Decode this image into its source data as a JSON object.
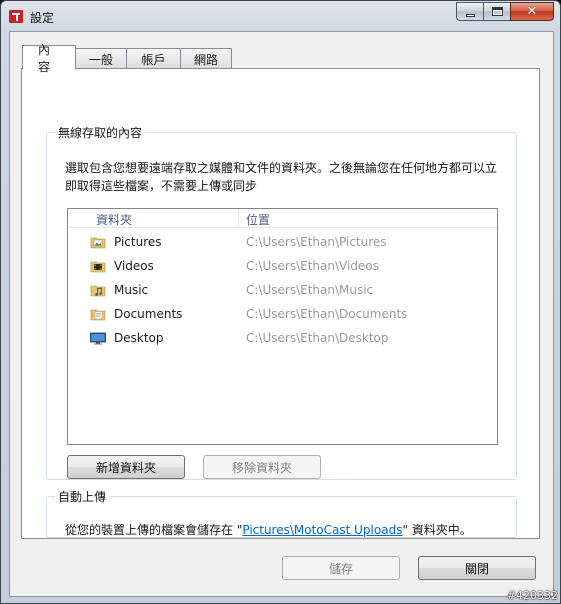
{
  "window": {
    "title": "設定"
  },
  "tabs": [
    {
      "label": "內容",
      "active": true
    },
    {
      "label": "一般",
      "active": false
    },
    {
      "label": "帳戶",
      "active": false
    },
    {
      "label": "網路",
      "active": false
    }
  ],
  "wireless": {
    "legend": "無線存取的內容",
    "description": "選取包含您想要遠端存取之媒體和文件的資料夾。之後無論您在任何地方都可以立即取得這些檔案，不需要上傳或同步",
    "columns": {
      "folder": "資料夾",
      "location": "位置"
    },
    "folders": [
      {
        "name": "Pictures",
        "path": "C:\\Users\\Ethan\\Pictures",
        "icon": "pictures-folder-icon"
      },
      {
        "name": "Videos",
        "path": "C:\\Users\\Ethan\\Videos",
        "icon": "videos-folder-icon"
      },
      {
        "name": "Music",
        "path": "C:\\Users\\Ethan\\Music",
        "icon": "music-folder-icon"
      },
      {
        "name": "Documents",
        "path": "C:\\Users\\Ethan\\Documents",
        "icon": "documents-folder-icon"
      },
      {
        "name": "Desktop",
        "path": "C:\\Users\\Ethan\\Desktop",
        "icon": "desktop-icon"
      }
    ],
    "add_button": "新增資料夾",
    "remove_button": "移除資料夾"
  },
  "auto_upload": {
    "legend": "自動上傳",
    "text_before": "從您的裝置上傳的檔案會儲存在 \"",
    "link": "Pictures\\MotoCast Uploads",
    "text_after": "\" 資料夾中。"
  },
  "footer": {
    "save": "儲存",
    "close": "關閉"
  },
  "watermark": "#420332",
  "colors": {
    "link": "#0066cc",
    "close_button": "#c1391c",
    "app_icon": "#c8232b"
  }
}
